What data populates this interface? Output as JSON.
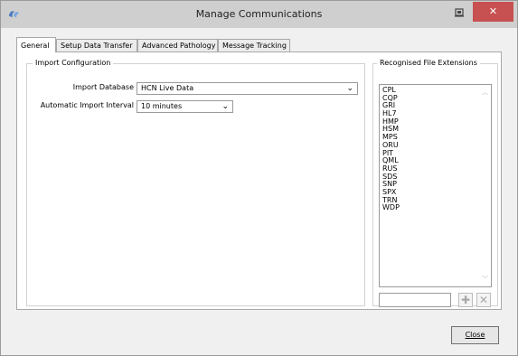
{
  "window": {
    "title": "Manage Communications",
    "close_glyph": "✕",
    "icons": {
      "app": "app-logo-icon",
      "pin": "pin-icon",
      "close": "close-icon"
    }
  },
  "tabs": [
    {
      "label": "General",
      "active": true
    },
    {
      "label": "Setup Data Transfer",
      "active": false
    },
    {
      "label": "Advanced Pathology",
      "active": false
    },
    {
      "label": "Message Tracking",
      "active": false
    }
  ],
  "import_config": {
    "legend": "Import Configuration",
    "database_label": "Import Database",
    "database_value": "HCN Live Data",
    "interval_label": "Automatic Import Interval",
    "interval_value": "10 minutes"
  },
  "extensions": {
    "legend": "Recognised File Extensions",
    "items": [
      "CPL",
      "CQP",
      "GRI",
      "HL7",
      "HMP",
      "HSM",
      "MPS",
      "ORU",
      "PIT",
      "QML",
      "RUS",
      "SDS",
      "SNP",
      "SPX",
      "TRN",
      "WDP"
    ],
    "new_value": "",
    "add_glyph": "✚",
    "remove_glyph": "✕"
  },
  "footer": {
    "close_label": "Close"
  },
  "colors": {
    "title_bar": "#cfcfcf",
    "close_button": "#c75050",
    "dialog_bg": "#f0f0f0"
  }
}
